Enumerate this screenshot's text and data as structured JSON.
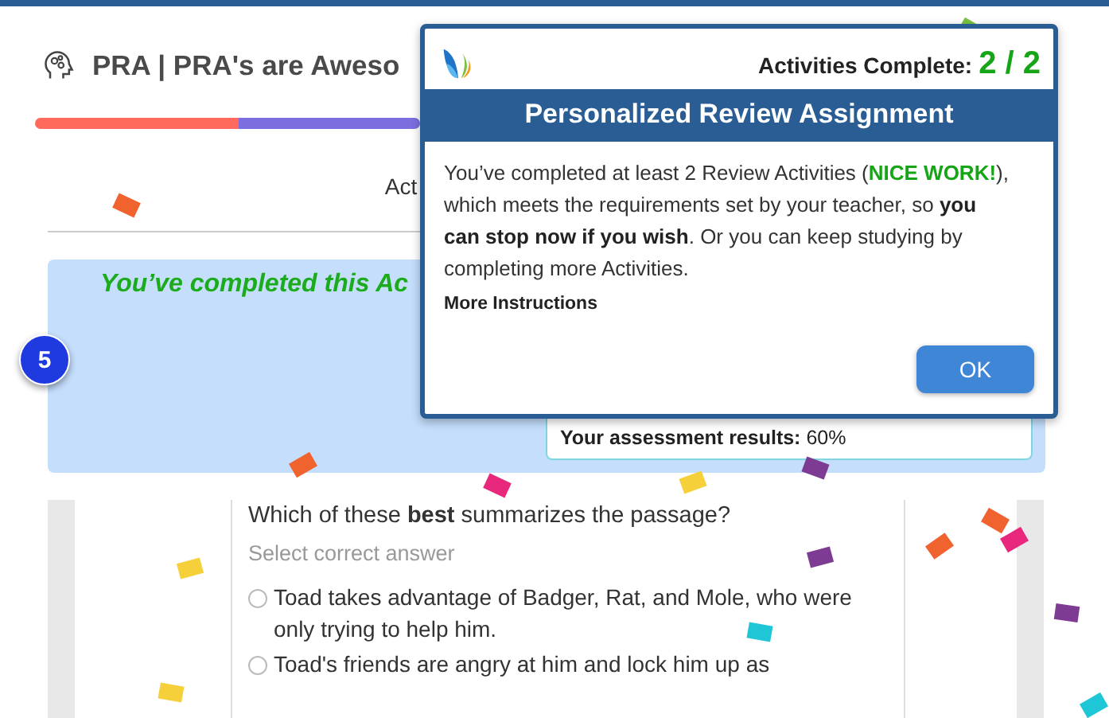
{
  "header": {
    "title": "PRA | PRA's are Aweso"
  },
  "progress": {
    "segments": [
      {
        "color": "#ff6a5c",
        "level": 0.53
      },
      {
        "color": "#7b6fe0",
        "level": 0.47
      }
    ]
  },
  "tab_label": "Act",
  "completion_banner": {
    "message": "You’ve completed this Ac",
    "step": "5",
    "results_label": "Your assessment results:",
    "results_value": "60%"
  },
  "question": {
    "prompt": "Which of these **best** summarizes the passage?",
    "hint": "Select correct answer",
    "options": [
      {
        "text": "Toad takes advantage of Badger, Rat, and Mole, who were only trying to help him.",
        "selected": false
      },
      {
        "text": "Toad's friends are angry at him and lock him up as",
        "selected": false
      }
    ]
  },
  "modal": {
    "progress_label": "Activities Complete:",
    "progress_count": "2 / 2",
    "title": "Personalized Review Assignment",
    "body": [
      {
        "kind": "text",
        "text": "You’ve completed at least 2 Review Activities ("
      },
      {
        "kind": "highlight",
        "text": "NICE WORK!"
      },
      {
        "kind": "text",
        "text": "), which meets the requirements set by your teacher, so "
      },
      {
        "kind": "bold",
        "text": "you can stop now if you wish"
      },
      {
        "kind": "text",
        "text": ". Or you can keep studying by completing more Activities."
      }
    ],
    "link": "More Instructions",
    "button": "OK"
  }
}
